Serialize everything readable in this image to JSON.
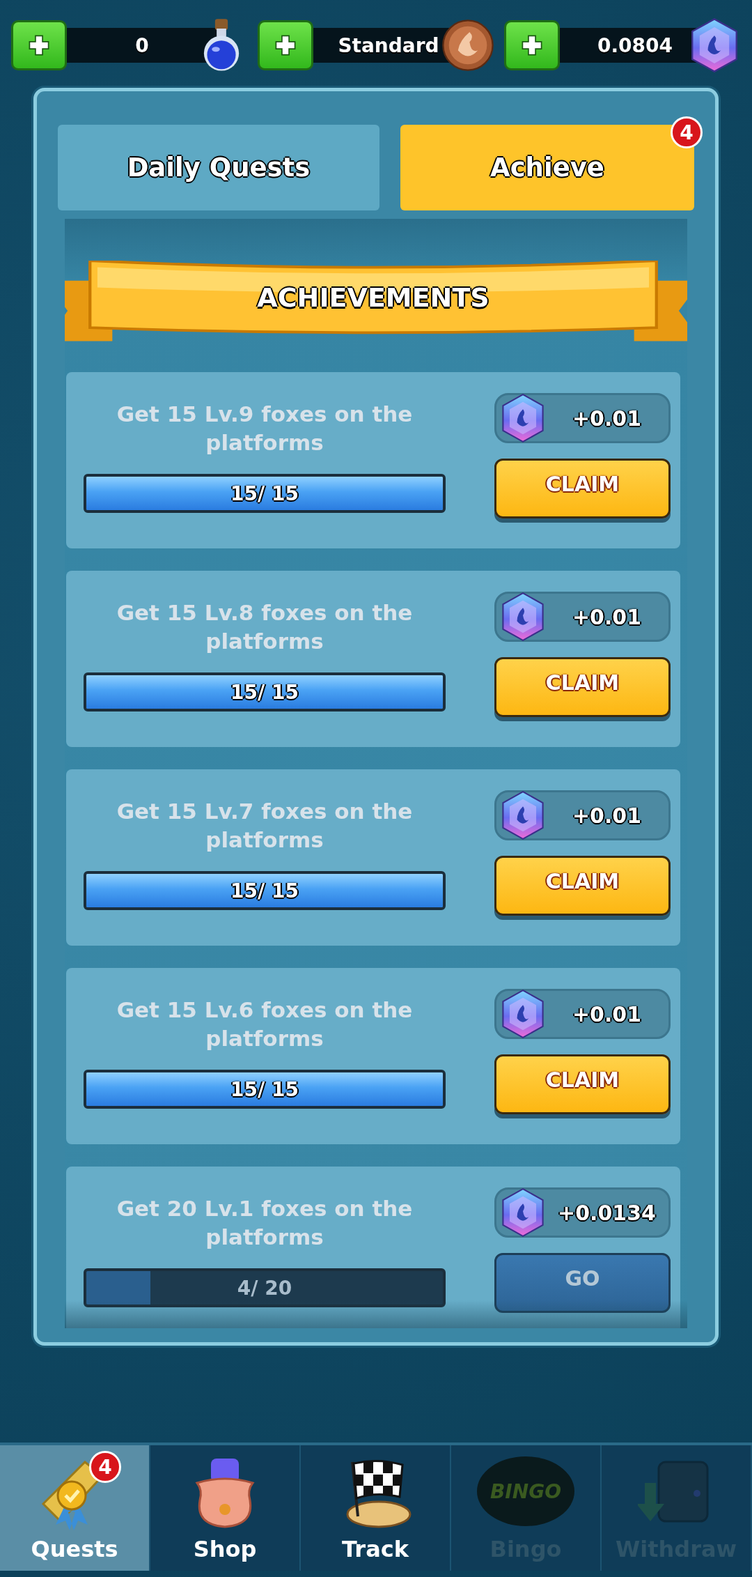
{
  "currencies": [
    {
      "kind": "potion",
      "value": "0"
    },
    {
      "kind": "coin",
      "value": "Standard"
    },
    {
      "kind": "gem",
      "value": "0.0804"
    }
  ],
  "tabs": [
    {
      "label": "Daily Quests",
      "selected": false
    },
    {
      "label": "Achieve",
      "selected": true,
      "badge": "4"
    }
  ],
  "banner": "ACHIEVEMENTS",
  "achievements": [
    {
      "kind": "claim",
      "title": "Get 15 Lv.9 foxes on the platforms",
      "level": 1,
      "progress": "15/ 15",
      "reward": "+0.01",
      "action": "CLAIM"
    },
    {
      "kind": "claim",
      "title": "Get 15 Lv.8 foxes on the platforms",
      "level": 1,
      "progress": "15/ 15",
      "reward": "+0.01",
      "action": "CLAIM"
    },
    {
      "kind": "claim",
      "title": "Get 15 Lv.7 foxes on the platforms",
      "level": 1,
      "progress": "15/ 15",
      "reward": "+0.01",
      "action": "CLAIM"
    },
    {
      "kind": "claim",
      "title": "Get 15 Lv.6 foxes on the platforms",
      "level": 1,
      "progress": "15/ 15",
      "reward": "+0.01",
      "action": "CLAIM"
    },
    {
      "kind": "go",
      "title": "Get 20 Lv.1 foxes on the platforms",
      "level": 0.18,
      "progress": "4/ 20",
      "reward": "+0.0134",
      "action": "GO"
    }
  ],
  "nav": [
    {
      "kind": "quests",
      "label": "Quests",
      "selected": true,
      "disabled": false,
      "badge": "4"
    },
    {
      "kind": "shop",
      "label": "Shop",
      "selected": false,
      "disabled": false
    },
    {
      "kind": "track",
      "label": "Track",
      "selected": false,
      "disabled": false
    },
    {
      "kind": "bingo",
      "label": "Bingo",
      "selected": false,
      "disabled": true,
      "icon_text": "BINGO"
    },
    {
      "kind": "withdraw",
      "label": "Withdraw",
      "selected": false,
      "disabled": true
    }
  ]
}
